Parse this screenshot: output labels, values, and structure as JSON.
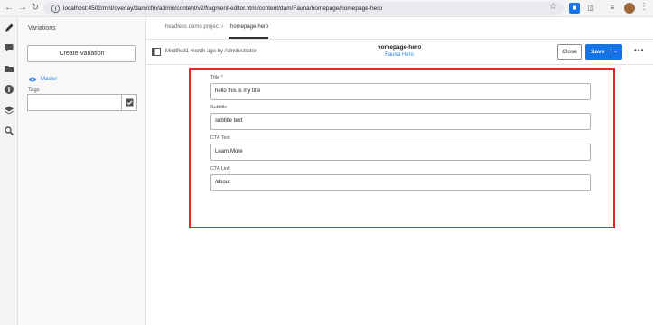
{
  "browser": {
    "back_icon": "arrow-left-icon",
    "url": "localhost:4502/mnt/overlay/dam/cfm/admin/content/v2/fragment-editor.html/content/dam/Fauna/homepage/homepage-hero"
  },
  "rail": {
    "icons": [
      "pencil-icon",
      "comment-icon",
      "folder-icon",
      "info-icon",
      "layers-icon",
      "search-settings-icon"
    ]
  },
  "variations": {
    "title": "Variations",
    "create_label": "Create Variation",
    "master_label": "Master",
    "tags_label": "Tags"
  },
  "breadcrumb": {
    "items": [
      "headless demo project",
      "homepage-hero"
    ]
  },
  "toolbar": {
    "modified": "Modified1 month ago by Administrator",
    "fragment_title": "homepage-hero",
    "model_name": "Fauna Hero",
    "close_label": "Close",
    "save_label": "Save"
  },
  "fields": [
    {
      "label": "Title *",
      "value": "hello this is my title"
    },
    {
      "label": "Subtitle",
      "value": "subtitle text"
    },
    {
      "label": "CTA Text",
      "value": "Learn More"
    },
    {
      "label": "CTA Link",
      "value": "/about"
    }
  ],
  "colors": {
    "accent": "#1473e6",
    "highlight_border": "#e02a2a"
  }
}
